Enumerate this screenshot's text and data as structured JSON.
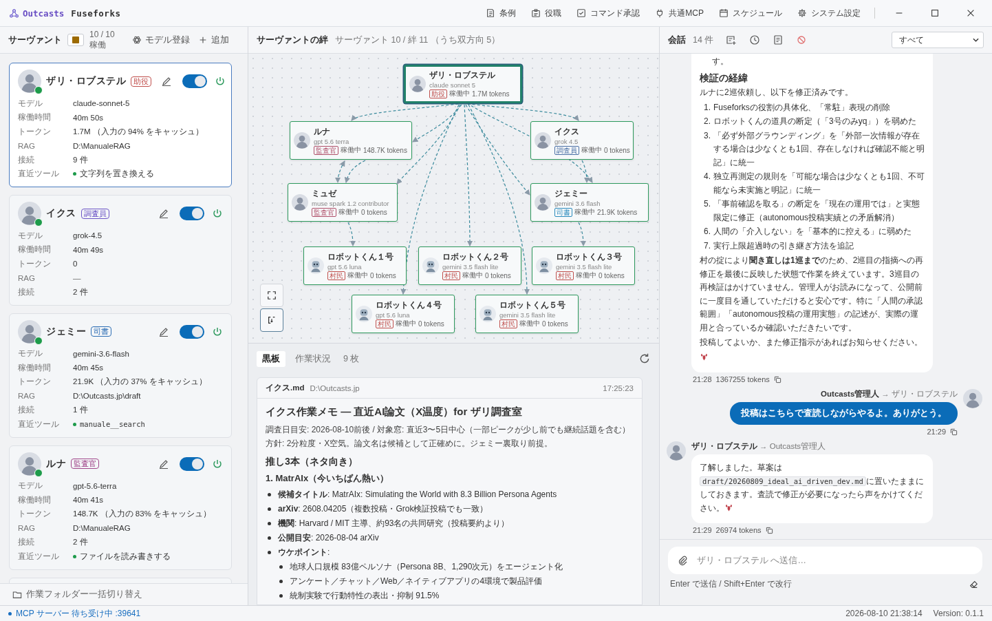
{
  "titlebar": {
    "brand": "Outcasts",
    "app": "Fuseforks",
    "menu": [
      {
        "label": "条例"
      },
      {
        "label": "役職"
      },
      {
        "label": "コマンド承認"
      },
      {
        "label": "共通MCP"
      },
      {
        "label": "スケジュール"
      },
      {
        "label": "システム設定"
      }
    ]
  },
  "servant_panel": {
    "title": "サーヴァント",
    "running": "10 / 10 稼働",
    "model_button": "モデル登録",
    "add_button": "追加",
    "partial_card": true,
    "folder_button": "作業フォルダー一括切り替え"
  },
  "servants": [
    {
      "name": "ザリ・ロブステル",
      "role": "助役",
      "color": "#c0504d",
      "selected": true,
      "online": true,
      "enabled": true,
      "rows": [
        {
          "label": "モデル",
          "value": "claude-sonnet-5",
          "kind": "plain"
        },
        {
          "label": "稼働時間",
          "value": "40m 50s",
          "kind": "plain"
        },
        {
          "label": "トークン",
          "value": "1.7M （入力の 94% をキャッシュ）",
          "kind": "plain"
        },
        {
          "label": "RAG",
          "value": "D:\\ManualeRAG",
          "kind": "plain"
        },
        {
          "label": "接続",
          "value": "9 件",
          "kind": "plain"
        },
        {
          "label": "直近ツール",
          "value": "文字列を置き換える",
          "kind": "tool"
        }
      ]
    },
    {
      "name": "イクス",
      "role": "調査員",
      "color": "#6b54c6",
      "selected": false,
      "online": true,
      "enabled": true,
      "rows": [
        {
          "label": "モデル",
          "value": "grok-4.5",
          "kind": "plain"
        },
        {
          "label": "稼働時間",
          "value": "40m 49s",
          "kind": "plain"
        },
        {
          "label": "トークン",
          "value": "0",
          "kind": "plain"
        },
        {
          "label": "RAG",
          "value": "—",
          "kind": "muted"
        },
        {
          "label": "接続",
          "value": "2 件",
          "kind": "plain"
        }
      ]
    },
    {
      "name": "ジェミー",
      "role": "司書",
      "color": "#2f6fb5",
      "selected": false,
      "online": true,
      "enabled": true,
      "rows": [
        {
          "label": "モデル",
          "value": "gemini-3.6-flash",
          "kind": "plain"
        },
        {
          "label": "稼働時間",
          "value": "40m 45s",
          "kind": "plain"
        },
        {
          "label": "トークン",
          "value": "21.9K （入力の 37% をキャッシュ）",
          "kind": "plain"
        },
        {
          "label": "RAG",
          "value": "D:\\Outcasts.jp\\draft",
          "kind": "plain"
        },
        {
          "label": "接続",
          "value": "1 件",
          "kind": "plain"
        },
        {
          "label": "直近ツール",
          "value": "manuale__search",
          "kind": "tool_code"
        }
      ]
    },
    {
      "name": "ルナ",
      "role": "監査官",
      "color": "#a0468a",
      "selected": false,
      "online": true,
      "enabled": true,
      "rows": [
        {
          "label": "モデル",
          "value": "gpt-5.6-terra",
          "kind": "plain"
        },
        {
          "label": "稼働時間",
          "value": "40m 41s",
          "kind": "plain"
        },
        {
          "label": "トークン",
          "value": "148.7K （入力の 83% をキャッシュ）",
          "kind": "plain"
        },
        {
          "label": "RAG",
          "value": "D:\\ManualeRAG",
          "kind": "plain"
        },
        {
          "label": "接続",
          "value": "2 件",
          "kind": "plain"
        },
        {
          "label": "直近ツール",
          "value": "ファイルを読み書きする",
          "kind": "tool"
        }
      ]
    }
  ],
  "graph": {
    "title": "サーヴァントの絆",
    "summary": "サーヴァント 10 / 絆 11 （うち双方向 5）",
    "nodes": [
      {
        "name": "ザリ・ロブステル",
        "model": "claude sonnet 5",
        "role": "助役",
        "color": "#c0504d",
        "status": "稼働中",
        "tokens": "1.7M tokens",
        "selected": true,
        "kind": "person"
      },
      {
        "name": "ルナ",
        "model": "gpt 5.6 terra",
        "role": "監査官",
        "color": "#b0506a",
        "status": "稼働中",
        "tokens": "148.7K tokens",
        "selected": false,
        "kind": "person"
      },
      {
        "name": "イクス",
        "model": "grok 4.5",
        "role": "調査員",
        "color": "#4a6fa5",
        "status": "稼働中",
        "tokens": "0 tokens",
        "selected": false,
        "kind": "person"
      },
      {
        "name": "ミュゼ",
        "model": "muse spark 1.2 contributor",
        "role": "監査官",
        "color": "#b0506a",
        "status": "稼働中",
        "tokens": "0 tokens",
        "selected": false,
        "kind": "person"
      },
      {
        "name": "ジェミー",
        "model": "gemini 3.6 flash",
        "role": "司書",
        "color": "#2a8bbd",
        "status": "稼働中",
        "tokens": "21.9K tokens",
        "selected": false,
        "kind": "person"
      },
      {
        "name": "ロボットくん１号",
        "model": "gpt 5.6 luna",
        "role": "村民",
        "color": "#c0504d",
        "status": "稼働中",
        "tokens": "0 tokens",
        "selected": false,
        "kind": "robot"
      },
      {
        "name": "ロボットくん２号",
        "model": "gemini 3.5 flash lite",
        "role": "村民",
        "color": "#c0504d",
        "status": "稼働中",
        "tokens": "0 tokens",
        "selected": false,
        "kind": "robot"
      },
      {
        "name": "ロボットくん３号",
        "model": "gemini 3.5 flash lite",
        "role": "村民",
        "color": "#c0504d",
        "status": "稼働中",
        "tokens": "0 tokens",
        "selected": false,
        "kind": "robot"
      },
      {
        "name": "ロボットくん４号",
        "model": "gpt 5.6 luna",
        "role": "村民",
        "color": "#c0504d",
        "status": "稼働中",
        "tokens": "0 tokens",
        "selected": false,
        "kind": "robot"
      },
      {
        "name": "ロボットくん５号",
        "model": "gemini 3.5 flash lite",
        "role": "村民",
        "color": "#c0504d",
        "status": "稼働中",
        "tokens": "0 tokens",
        "selected": false,
        "kind": "robot"
      }
    ]
  },
  "blackboard": {
    "tabs": [
      {
        "label": "黒板",
        "selected": true
      },
      {
        "label": "作業状況",
        "selected": false
      }
    ],
    "count": "9 枚",
    "card": {
      "file": "イクス.md",
      "path": "D:\\Outcasts.jp",
      "time": "17:25:23",
      "blocks": [
        {
          "kind": "h1",
          "text": "イクス作業メモ — 直近AI論文（X温度）for ザリ調査室"
        },
        {
          "kind": "line",
          "text": "調査日目安: 2026-08-10前後 / 対象窓: 直近3〜5日中心（一部ピークが少し前でも継続話題を含む）"
        },
        {
          "kind": "line",
          "text": "方針: 2分粒度・X空気。論文名は候補として正確めに。ジェミー裏取り前提。"
        },
        {
          "kind": "h2",
          "text": "推し3本（ネタ向き）"
        },
        {
          "kind": "h3",
          "text": "1. MatrAIx（今いちばん熱い）"
        },
        {
          "kind": "li",
          "text": "**候補タイトル**: MatrAIx: Simulating the World with 8.3 Billion Persona Agents"
        },
        {
          "kind": "li",
          "text": "**arXiv**: 2608.04205（複数投稿・Grok検証投稿でも一致）"
        },
        {
          "kind": "li",
          "text": "**機関**: Harvard / MIT 主導、約93名の共同研究（投稿要約より）"
        },
        {
          "kind": "li",
          "text": "**公開目安**: 2026-08-04 arXiv"
        },
        {
          "kind": "li",
          "text": "**ウケポイント**:"
        },
        {
          "kind": "li2",
          "text": "地球人口規模 83億ペルソナ（Persona 8B、1,290次元）をエージェント化"
        },
        {
          "kind": "li2",
          "text": "アンケート／チャット／Web／ネイティブアプリの4環境で製品評価"
        },
        {
          "kind": "li2",
          "text": "統制実験で行動特性の表出・抑制 91.5%"
        }
      ]
    }
  },
  "chat": {
    "title": "会話",
    "count": "14 件",
    "filter": "すべて",
    "messages": [
      {
        "kind": "received",
        "blocks": [
          {
            "kind": "cont",
            "text": "す。"
          },
          {
            "kind": "h",
            "text": "検証の経緯"
          },
          {
            "kind": "p",
            "text": "ルナに2巡依頼し、以下を修正済みです。"
          },
          {
            "kind": "ol",
            "num": "1.",
            "text": "Fuseforksの役割の具体化、「常駐」表現の削除"
          },
          {
            "kind": "ol",
            "num": "2.",
            "text": "ロボットくんの道具の断定（「3号のみyq」）を弱めた"
          },
          {
            "kind": "ol",
            "num": "3.",
            "text": "「必ず外部グラウンディング」を「外部一次情報が存在する場合は少なくとも1回、存在しなければ確認不能と明記」に統一"
          },
          {
            "kind": "ol",
            "num": "4.",
            "text": "独立再測定の規則を「可能な場合は少なくとも1回、不可能なら未実施と明記」に統一"
          },
          {
            "kind": "ol",
            "num": "5.",
            "text": "「事前確認を取る」の断定を「現在の運用では」と実態限定に修正（autonomous投稿実績との矛盾解消）"
          },
          {
            "kind": "ol",
            "num": "6.",
            "text": "人間の「介入しない」を「基本的に控える」に弱めた"
          },
          {
            "kind": "ol",
            "num": "7.",
            "text": "実行上限超過時の引き継ぎ方法を追記"
          },
          {
            "kind": "p",
            "text": "村の掟により**聞き直しは1巡まで**のため、2巡目の指摘への再修正を最後に反映した状態で作業を終えています。3巡目の再検証はかけていません。管理人がお読みになって、公開前に一度目を通していただけると安心です。特に「人間の承認範囲」「autonomous投稿の運用実態」の記述が、実際の運用と合っているか確認いただきたいです。"
          },
          {
            "kind": "p",
            "text": "投稿してよいか、また修正指示があればお知らせください。"
          },
          {
            "kind": "emoji"
          }
        ],
        "time": "21:28",
        "tokens": "1367255 tokens"
      },
      {
        "kind": "sent",
        "from": "Outcasts管理人",
        "to": "→ ザリ・ロブステル",
        "text": "投稿はこちらで査読しながらやるよ。ありがとう。",
        "time": "21:29"
      },
      {
        "kind": "received",
        "from": "ザリ・ロブステル",
        "to": "→ Outcasts管理人",
        "blocks": [
          {
            "kind": "parts",
            "parts": [
              {
                "kind": "text",
                "text": "了解しました。草案は"
              },
              {
                "kind": "code",
                "text": "draft/20260809_ideal_ai_driven_dev.md"
              },
              {
                "kind": "text",
                "text": "に置いたままにしておきます。査読で修正が必要になったら声をかけてください。"
              },
              {
                "kind": "emoji"
              }
            ]
          }
        ],
        "time": "21:29",
        "tokens": "26974 tokens"
      }
    ],
    "placeholder": "ザリ・ロブステル へ送信…",
    "hint": "Enter で送信 / Shift+Enter で改行"
  },
  "status_bar": {
    "server": "MCP サーバー 待ち受け中 :39641",
    "datetime": "2026-08-10 21:38:14",
    "version": "Version: 0.1.1"
  }
}
